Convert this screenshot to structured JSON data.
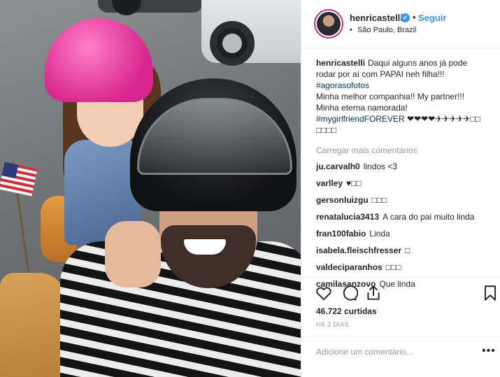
{
  "post": {
    "username": "henricastelli",
    "follow_label": "Seguir",
    "location": "São Paulo, Brazil",
    "caption": {
      "user": "henricastelli",
      "line1": "Daqui alguns anos já pode",
      "line2": "rodar por aí com PAPAI neh filha!!!",
      "tag1": "#agorasofotos",
      "line3": "Minha melhor companhia!! My partner!!!",
      "line4": "Minha eterna namorada!",
      "tag2": "#mygirlfriendFOREVER",
      "emoji_tail": " ❤❤❤❤✈✈✈✈✈□□",
      "emoji_line2": "□□□□"
    },
    "load_more": "Carregar mais comentários",
    "comments": [
      {
        "user": "ju.carvalh0",
        "text": "lindos <3"
      },
      {
        "user": "varlley",
        "text": "♥□□"
      },
      {
        "user": "gersonluizgu",
        "text": "□□□"
      },
      {
        "user": "renatalucia3413",
        "text": "A cara do pai muito linda"
      },
      {
        "user": "fran100fabio",
        "text": "Linda"
      },
      {
        "user": "isabela.fleischfresser",
        "text": "□"
      },
      {
        "user": "valdeciparanhos",
        "text": "□□□"
      },
      {
        "user": "camilasanzovo",
        "text": "Que linda"
      }
    ],
    "likes": "46.722 curtidas",
    "time": "HÁ 2 DIAS",
    "add_comment_placeholder": "Adicione um comentário...",
    "more_options": "•••"
  },
  "icons": {
    "verified": "✔",
    "like": "heart-icon",
    "comment": "comment-icon",
    "share": "share-icon",
    "save": "bookmark-icon"
  },
  "colors": {
    "link_blue": "#3897f0",
    "hashtag": "#003569",
    "muted": "#999999",
    "text": "#262626",
    "avatar_ring": "#c13584"
  }
}
